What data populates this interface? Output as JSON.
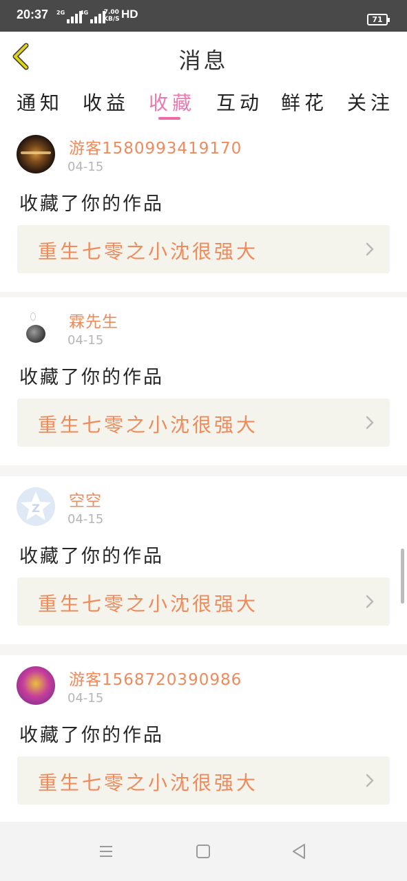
{
  "status_bar": {
    "time": "20:37",
    "network_1": "2G",
    "network_2": "4G",
    "speed_value": "7.00",
    "speed_unit": "KB/S",
    "hd_label": "HD",
    "battery": "71"
  },
  "header": {
    "title": "消息",
    "back_icon": "chevron-left-icon",
    "accent_color": "#e0d21b"
  },
  "tabs": [
    {
      "label": "通知",
      "active": false
    },
    {
      "label": "收益",
      "active": false
    },
    {
      "label": "收藏",
      "active": true
    },
    {
      "label": "互动",
      "active": false
    },
    {
      "label": "鲜花",
      "active": false
    },
    {
      "label": "关注",
      "active": false
    }
  ],
  "colors": {
    "active_tab": "#e97ab0",
    "username": "#ee8a5c",
    "work_title": "#ef8a5a",
    "work_box_bg": "#f4f3ec"
  },
  "items": [
    {
      "username": "游客1580993419170",
      "date": "04-15",
      "action": "收藏了你的作品",
      "work_title": "重生七零之小沈很强大",
      "avatar": "avatar-photo-lights"
    },
    {
      "username": "霖先生",
      "date": "04-15",
      "action": "收藏了你的作品",
      "work_title": "重生七零之小沈很强大",
      "avatar": "avatar-ink-drawing"
    },
    {
      "username": "空空",
      "date": "04-15",
      "action": "收藏了你的作品",
      "work_title": "重生七零之小沈很强大",
      "avatar": "avatar-qzone-star"
    },
    {
      "username": "游客1568720390986",
      "date": "04-15",
      "action": "收藏了你的作品",
      "work_title": "重生七零之小沈很强大",
      "avatar": "avatar-cartoon"
    }
  ],
  "nav_bar": {
    "menu_icon": "menu-icon",
    "home_icon": "home-square-icon",
    "back_icon": "back-triangle-icon"
  }
}
